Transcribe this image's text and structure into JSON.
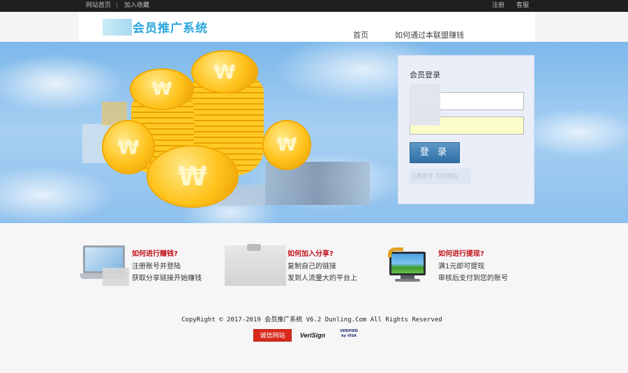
{
  "topbar": {
    "links": [
      "网站首页",
      "加入收藏"
    ],
    "separator": "|",
    "right": [
      "注册",
      "客服"
    ]
  },
  "header": {
    "logo_text": "会员推广系统",
    "nav": [
      "首页",
      "如何通过本联盟赚钱"
    ]
  },
  "login": {
    "title": "会员登录",
    "username_value": "",
    "password_value": "••••••",
    "submit_label": "登 录",
    "links_text": "注册账号  忘记密码"
  },
  "features": [
    {
      "title": "如何进行赚钱?",
      "lines": [
        "注册账号并登陆",
        "获取分享链接开始赚钱"
      ],
      "icon": "laptop-icon"
    },
    {
      "title": "如何加入分享?",
      "lines": [
        "复制自己的链接",
        "发到人流量大的平台上"
      ],
      "icon": "clipboard-icon"
    },
    {
      "title": "如何进行提现?",
      "lines": [
        "满1元即可提现",
        "审核后支付到您的账号"
      ],
      "icon": "monitor-icon"
    }
  ],
  "footer": {
    "copyright": "CopyRight © 2017-2019 会员推广系统 V6.2 Dunling.Com All Rights Reserved",
    "badges": [
      "诚信网站",
      "VeriSign",
      "VERIFIED by VISA"
    ]
  },
  "colors": {
    "accent_blue": "#2aa6dc",
    "feature_red": "#c0121a",
    "button_blue": "#2d6fa6"
  }
}
